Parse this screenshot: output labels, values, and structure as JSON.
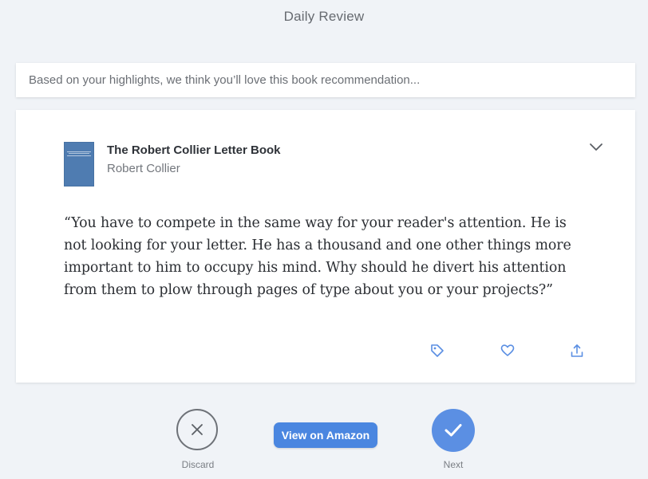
{
  "header": {
    "title": "Daily Review"
  },
  "banner": {
    "text": "Based on your highlights, we think you’ll love this book recommendation..."
  },
  "card": {
    "book": {
      "title": "The Robert Collier Letter Book",
      "author": "Robert Collier",
      "cover_color": "#4f7cb1"
    },
    "quote": "“You have to compete in the same way for your reader's attention. He is not looking for your letter. He has a thousand and one other things more important to him to occupy his mind. Why should he divert his attention from them to plow through pages of type about you or your projects?”",
    "actions": [
      {
        "icon": "tag-icon"
      },
      {
        "icon": "heart-icon"
      },
      {
        "icon": "share-icon"
      }
    ],
    "action_color": "#5b8fe3"
  },
  "footer": {
    "discard_label": "Discard",
    "amazon_label": "View on Amazon",
    "next_label": "Next",
    "accent": "#4a86e0"
  }
}
